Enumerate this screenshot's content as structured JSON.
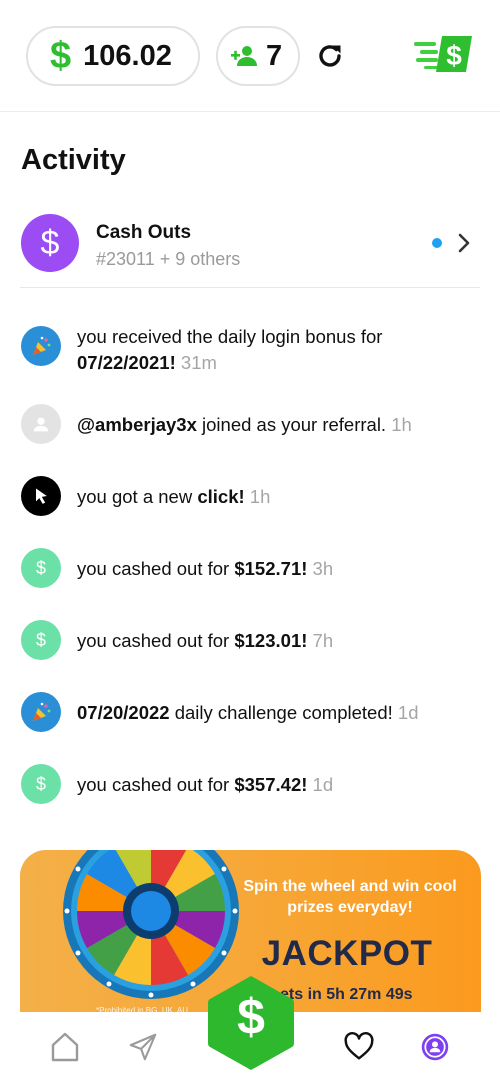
{
  "header": {
    "currency_symbol": "$",
    "balance": "106.02",
    "referral_count": "7",
    "colors": {
      "green": "#2fbe2f",
      "pill_border": "#e2e2e2"
    }
  },
  "activity": {
    "title": "Activity",
    "cashouts": {
      "avatar_symbol": "$",
      "title": "Cash Outs",
      "subtitle": "#23011 + 9 others",
      "avatar_color": "#9b4df3",
      "unread_color": "#1da1f2"
    },
    "feed": [
      {
        "icon": "party-popper-icon",
        "line1": "you received the daily login bonus for",
        "bold": "07/22/2021!",
        "time": "31m"
      },
      {
        "icon": "user-icon",
        "bold": "@amberjay3x",
        "text": " joined as your referral.",
        "time": "1h"
      },
      {
        "icon": "cursor-icon",
        "text": "you got a new ",
        "bold": "click!",
        "time": "1h"
      },
      {
        "icon": "dollar-icon",
        "symbol": "$",
        "text": "you cashed out for ",
        "bold": "$152.71!",
        "time": "3h"
      },
      {
        "icon": "dollar-icon",
        "symbol": "$",
        "text": "you cashed out for ",
        "bold": "$123.01!",
        "time": "7h"
      },
      {
        "icon": "party-popper-icon",
        "bold": "07/20/2022",
        "text": " daily challenge completed!",
        "time": "1d"
      },
      {
        "icon": "dollar-icon",
        "symbol": "$",
        "text": "you cashed out for ",
        "bold": "$357.42!",
        "time": "1d"
      }
    ]
  },
  "banner": {
    "promo": "Spin the wheel and win cool prizes everyday!",
    "jackpot": "JACKPOT",
    "reset_prefix": "…ets in ",
    "reset_time": "5h 27m 49s",
    "disclaimer": "*Prohibited in BG, UK, AU",
    "bg_color": "#f7a635"
  },
  "nav": {
    "fab_symbol": "$",
    "fab_color": "#2db82d"
  }
}
